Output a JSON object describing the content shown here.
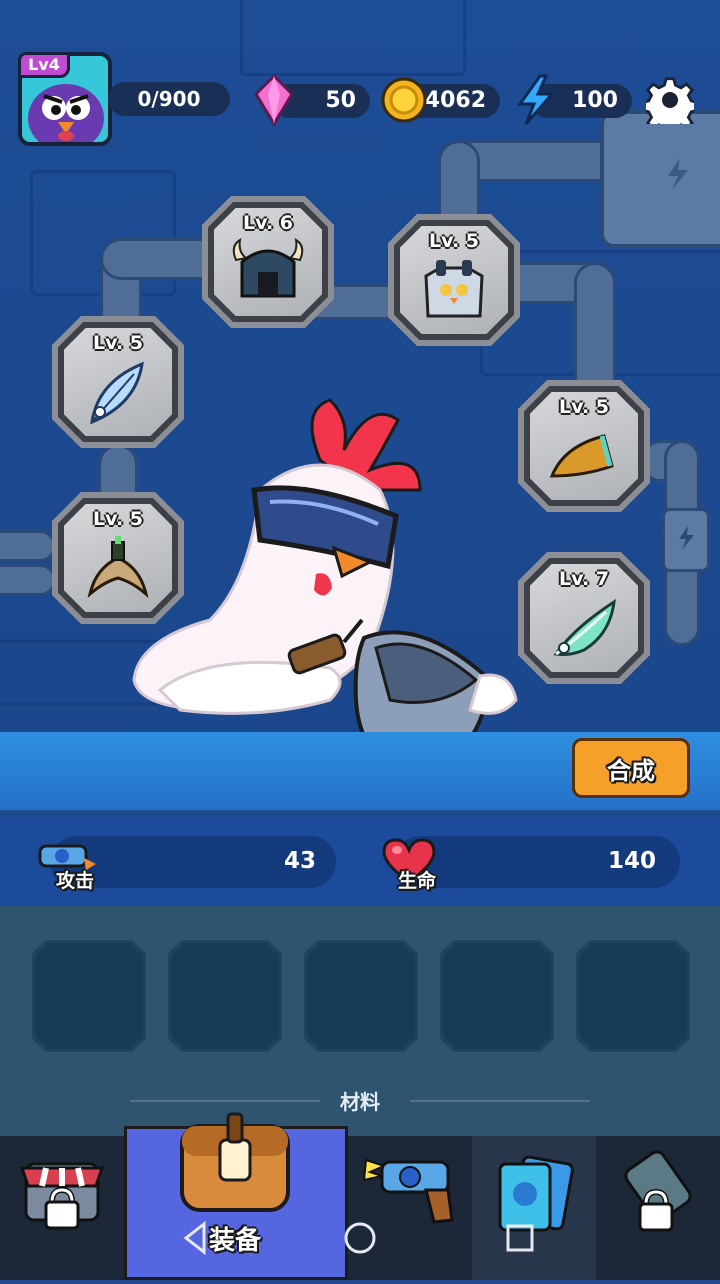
{
  "player": {
    "level_badge": "Lv4",
    "xp_text": "0/900"
  },
  "currencies": {
    "gems": "50",
    "gold": "4062",
    "energy": "100"
  },
  "icons": {
    "avatar": "purple-bird-avatar",
    "gem": "pink-gem-icon",
    "gold": "gold-coin-icon",
    "energy": "lightning-icon",
    "settings": "gear-icon",
    "attack": "blaster-icon",
    "hp": "heart-icon"
  },
  "equipment": [
    {
      "slot": "helmet",
      "level": "Lv. 6",
      "icon": "horned-helmet-icon"
    },
    {
      "slot": "armor",
      "level": "Lv. 5",
      "icon": "owl-armor-icon"
    },
    {
      "slot": "feather",
      "level": "Lv. 5",
      "icon": "feather-icon"
    },
    {
      "slot": "beak",
      "level": "Lv. 5",
      "icon": "beak-icon"
    },
    {
      "slot": "claw",
      "level": "Lv. 5",
      "icon": "claw-icon"
    },
    {
      "slot": "wing",
      "level": "Lv. 7",
      "icon": "wing-icon"
    }
  ],
  "merge_button": "合成",
  "stats": {
    "attack_label": "攻击",
    "attack_value": "43",
    "hp_label": "生命",
    "hp_value": "140"
  },
  "materials": {
    "title": "材料",
    "slots": 5
  },
  "nav": {
    "active_label": "装备",
    "tabs": [
      "shop-locked",
      "equipment",
      "weapon",
      "cards",
      "locked"
    ]
  },
  "colors": {
    "accent": "#f5a028",
    "background": "#1f4a8f",
    "active_tab": "#5566e0"
  }
}
